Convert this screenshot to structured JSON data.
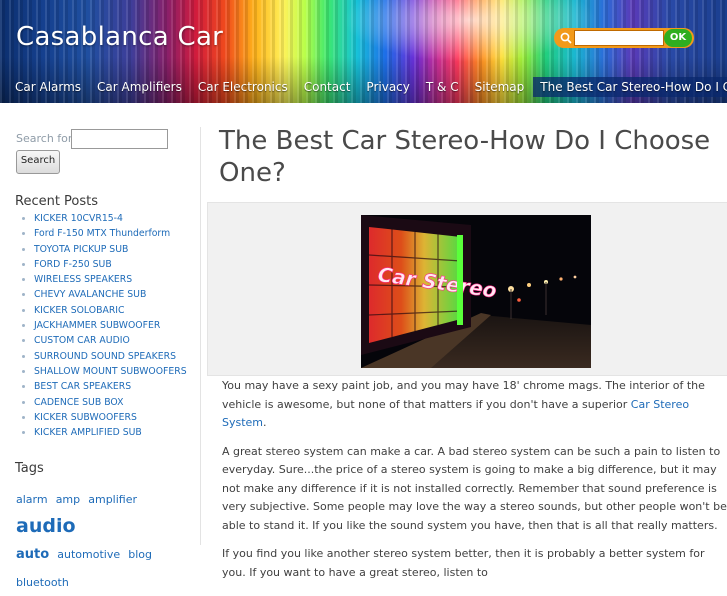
{
  "site": {
    "title": "Casablanca Car",
    "search_ok_label": "OK",
    "search_placeholder": ""
  },
  "nav": {
    "items": [
      "Car Alarms",
      "Car Amplifiers",
      "Car Electronics",
      "Contact",
      "Privacy",
      "T & C",
      "Sitemap"
    ],
    "current": "The Best Car Stereo-How Do I Choose One?"
  },
  "sidebar": {
    "search_label": "Search for:",
    "search_value": "",
    "search_button": "Search",
    "recent_title": "Recent Posts",
    "recent_posts": [
      "KICKER 10CVR15-4",
      "Ford F-150 MTX Thunderform",
      "TOYOTA PICKUP SUB",
      "FORD F-250 SUB",
      "WIRELESS SPEAKERS",
      "CHEVY AVALANCHE SUB",
      "KICKER SOLOBARIC",
      "JACKHAMMER SUBWOOFER",
      "CUSTOM CAR AUDIO",
      "SURROUND SOUND SPEAKERS",
      "SHALLOW MOUNT SUBWOOFERS",
      "BEST CAR SPEAKERS",
      "CADENCE SUB BOX",
      "KICKER SUBWOOFERS",
      "KICKER AMPLIFIED SUB"
    ],
    "tags_title": "Tags",
    "tags": [
      "alarm",
      "amp",
      "amplifier",
      "audio",
      "auto",
      "automotive",
      "blog",
      "bluetooth"
    ]
  },
  "post": {
    "title": "The Best Car Stereo-How Do I Choose One?",
    "image_sign_text": "Car Stereo",
    "p1_before": "You may have a sexy paint job, and you may have 18' chrome mags. The interior of the vehicle is awesome, but none of that matters if you don't have a superior ",
    "p1_link": "Car Stereo System",
    "p1_after": ".",
    "p2": "A great stereo system can make a car. A bad stereo system can be such a pain to listen to everyday. Sure...the price of a stereo system is going to make a big difference, but it may not make any difference if it is not installed correctly. Remember that sound preference is very subjective. Some people may love the way a stereo sounds, but other people won't be able to stand it. If you like the sound system you have, then that is all that really matters.",
    "p3": "If you find you like another stereo system better, then it is probably a better system for you. If you want to have a great stereo, listen to"
  }
}
